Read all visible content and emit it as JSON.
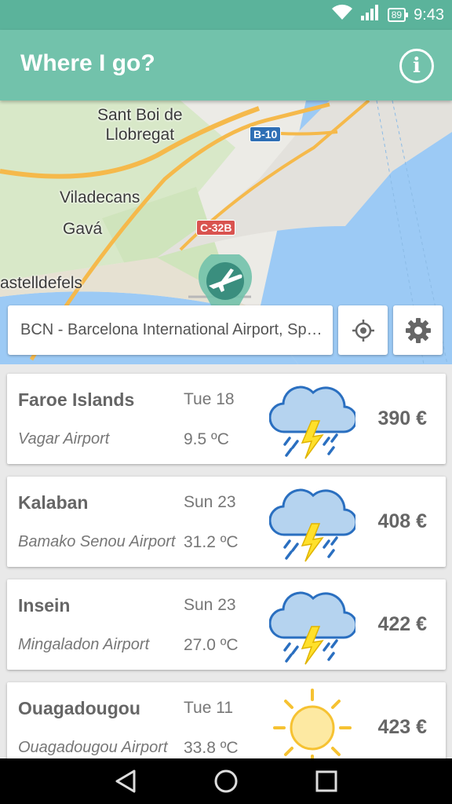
{
  "status_bar": {
    "battery": "89",
    "time": "9:43",
    "icons": [
      "wifi-icon",
      "signal-icon",
      "battery-icon"
    ]
  },
  "app_bar": {
    "title": "Where I go?",
    "info_icon": "info-icon"
  },
  "map": {
    "labels": {
      "sant_boi": "Sant Boi de\nLlobregat",
      "viladecans": "Viladecans",
      "gava": "Gavá",
      "castelldefels": "astelldefels"
    },
    "road_shields": {
      "b10": "B-10",
      "c32": "C-32B"
    },
    "pin_icon": "airplane-icon"
  },
  "search": {
    "value": "BCN - Barcelona International Airport, Spain"
  },
  "buttons": {
    "locate_icon": "my-location-icon",
    "settings_icon": "gear-icon"
  },
  "destinations": [
    {
      "city": "Faroe Islands",
      "airport": "Vagar Airport",
      "date": "Tue 18",
      "temp": "9.5 ºC",
      "weather": "thunderstorm-icon",
      "price": "390 €"
    },
    {
      "city": "Kalaban",
      "airport": "Bamako Senou Airport",
      "date": "Sun 23",
      "temp": "31.2 ºC",
      "weather": "thunderstorm-icon",
      "price": "408 €"
    },
    {
      "city": "Insein",
      "airport": "Mingaladon Airport",
      "date": "Sun 23",
      "temp": "27.0 ºC",
      "weather": "thunderstorm-icon",
      "price": "422 €"
    },
    {
      "city": "Ouagadougou",
      "airport": "Ouagadougou Airport",
      "date": "Tue 11",
      "temp": "33.8 ºC",
      "weather": "sun-icon",
      "price": "423 €"
    }
  ],
  "nav": {
    "back_icon": "back-icon",
    "home_icon": "home-icon",
    "recents_icon": "recents-icon"
  },
  "colors": {
    "primary": "#72c2ab",
    "status": "#5bb39b",
    "cloud": "#b5d3ef",
    "cloud_stroke": "#2a6fc0",
    "bolt": "#ffe02b",
    "sun": "#fde9a2",
    "sun_stroke": "#f6c232"
  }
}
